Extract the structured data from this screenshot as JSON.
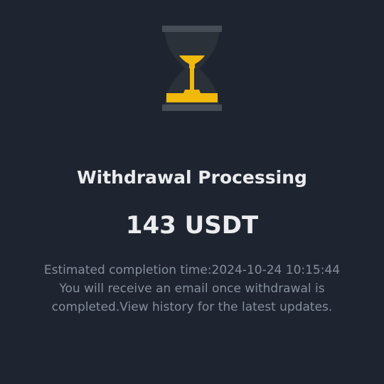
{
  "status": {
    "title": "Withdrawal Processing",
    "amount": "143 USDT",
    "icon": "hourglass-icon"
  },
  "details": {
    "estimate_label": "Estimated completion time:",
    "estimate_value": "2024-10-24 10:15:44",
    "email_notice": "You will receive an email once withdrawal is",
    "completed_text": "completed.",
    "history_link": "View history",
    "latest_updates": " for the latest updates."
  },
  "colors": {
    "background": "#1f2530",
    "accent": "#f0b90b",
    "primary_text": "#eaecef",
    "secondary_text": "#848e9c",
    "icon_frame": "#474d57"
  }
}
